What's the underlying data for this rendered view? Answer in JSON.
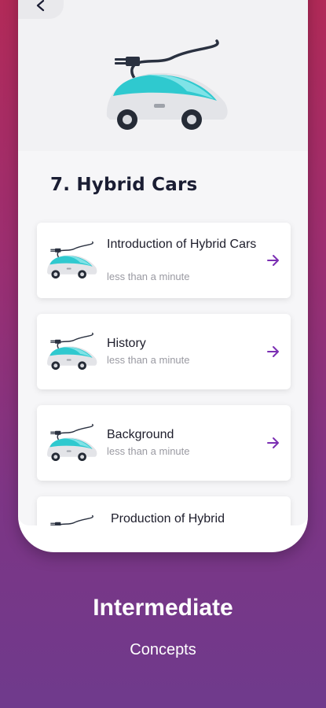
{
  "lesson": {
    "title": "7. Hybrid Cars"
  },
  "topics": [
    {
      "title": "Introduction of Hybrid Cars",
      "duration": "less than a minute"
    },
    {
      "title": "History",
      "duration": "less than a minute"
    },
    {
      "title": "Background",
      "duration": "less than a minute"
    },
    {
      "title": "Production of Hybrid",
      "duration": ""
    }
  ],
  "caption": {
    "heading": "Intermediate",
    "subheading": "Concepts"
  },
  "colors": {
    "accent": "#7b2fb3",
    "car_teal": "#2fc9cf",
    "background_top": "#b22a58",
    "background_bottom": "#6f3a8c"
  },
  "icons": {
    "back": "arrow-left-icon",
    "next": "arrow-right-icon",
    "thumbnail": "hybrid-car-plug-icon"
  }
}
